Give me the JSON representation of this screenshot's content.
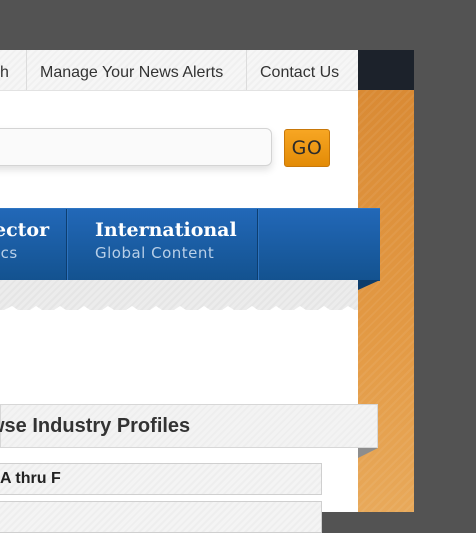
{
  "topnav": {
    "items": [
      "ch",
      "Manage Your News Alerts",
      "Contact Us"
    ]
  },
  "search": {
    "value": "",
    "go_label": "GO"
  },
  "tabs": [
    {
      "title": "ector",
      "subtitle": "ics"
    },
    {
      "title": "International",
      "subtitle": "Global Content"
    }
  ],
  "panel": {
    "title": "wse Industry Profiles",
    "rows": [
      "A thru F",
      ""
    ]
  },
  "colors": {
    "blue_bar": "#1a5da3",
    "go_button": "#f09a14",
    "orange_sidebar": "#e09440",
    "dark_header": "#1c222b"
  }
}
